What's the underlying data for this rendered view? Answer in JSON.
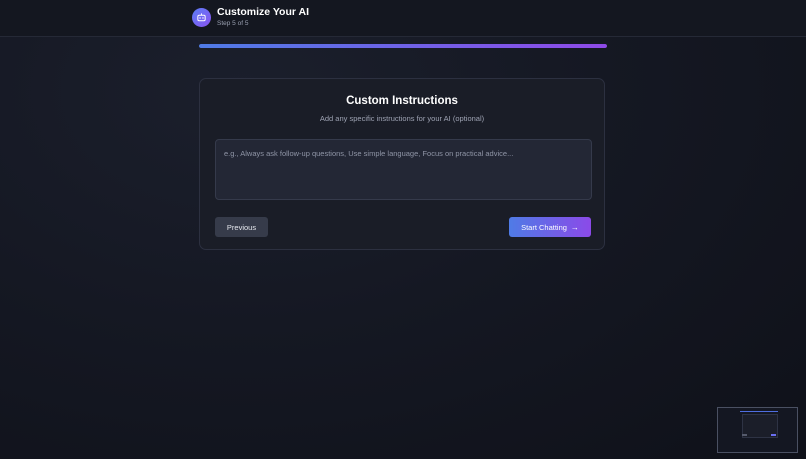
{
  "header": {
    "title": "Customize Your AI",
    "step": "Step 5 of 5",
    "logo_icon": "robot-icon"
  },
  "progress": {
    "fraction": 1.0,
    "colors": [
      "#4f7be6",
      "#8f4ae8"
    ]
  },
  "card": {
    "title": "Custom Instructions",
    "subtitle": "Add any specific instructions for your AI (optional)",
    "textarea_placeholder": "e.g., Always ask follow-up questions, Use simple language, Focus on practical advice...",
    "textarea_value": ""
  },
  "buttons": {
    "previous_label": "Previous",
    "start_label": "Start Chatting",
    "start_icon": "arrow-right-icon"
  },
  "colors": {
    "accent_start": "#4f7be6",
    "accent_end": "#8b4ae8",
    "background": "#151823"
  }
}
